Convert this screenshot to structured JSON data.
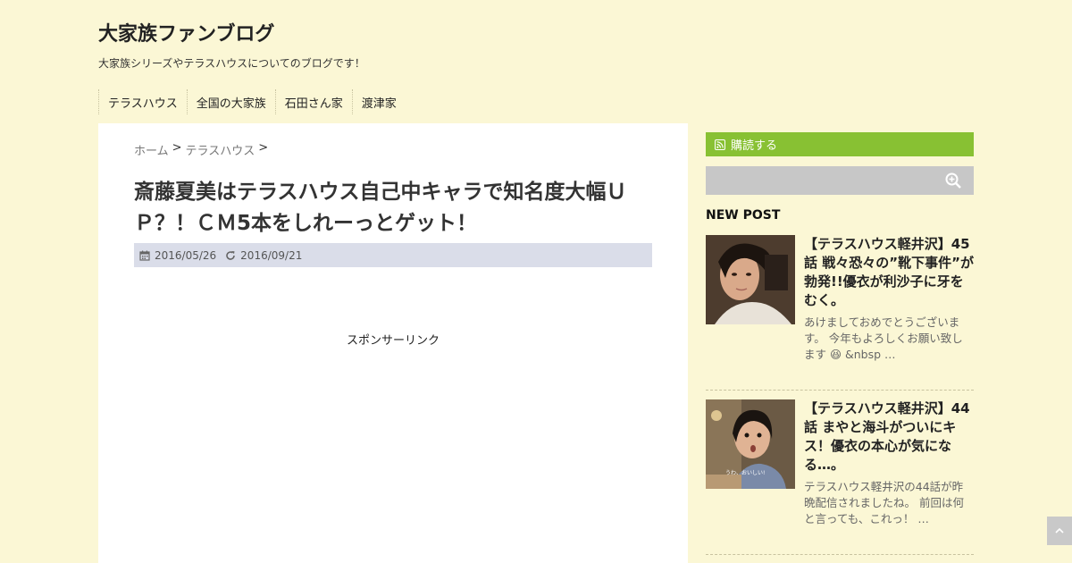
{
  "site": {
    "title": "大家族ファンブログ",
    "description": "大家族シリーズやテラスハウスについてのブログです！"
  },
  "nav": {
    "items": [
      {
        "label": "テラスハウス"
      },
      {
        "label": "全国の大家族"
      },
      {
        "label": "石田さん家"
      },
      {
        "label": "渡津家"
      }
    ]
  },
  "breadcrumb": {
    "home": "ホーム",
    "sep1": ">",
    "category": "テラスハウス",
    "sep2": ">"
  },
  "post": {
    "title": "斎藤夏美はテラスハウス自己中キャラで知名度大幅ＵＰ？！ＣＭ5本をしれーっとゲット！",
    "published": "2016/05/26",
    "updated": "2016/09/21",
    "sponsor_label": "スポンサーリンク"
  },
  "sidebar": {
    "subscribe_label": "購読する",
    "new_post_heading": "NEW POST",
    "posts": [
      {
        "title": "【テラスハウス軽井沢】45話 戦々恐々の”靴下事件”が勃発!!優衣が利沙子に牙をむく。",
        "excerpt_a": "あけましておめでとうございます。 今年もよろしくお願い致します",
        "emoji": "😆",
        "excerpt_b": "&nbsp …"
      },
      {
        "title": "【テラスハウス軽井沢】44話 まやと海斗がついにキス！優衣の本心が気になる…。",
        "excerpt_a": "テラスハウス軽井沢の44話が昨晩配信されましたね。 前回は何と言っても、これっ！ …",
        "thumb_caption": "うわ、おいしい!"
      }
    ]
  },
  "colors": {
    "page_bg": "#fbf7d5",
    "subscribe_bg": "#88c133",
    "meta_bar_bg": "#dadde9",
    "search_bg": "#c7c7c7"
  },
  "icons": {
    "calendar": "calendar-icon",
    "updated": "refresh-icon",
    "rss": "rss-icon",
    "search": "search-icon",
    "scroll_top": "chevron-up-icon"
  }
}
